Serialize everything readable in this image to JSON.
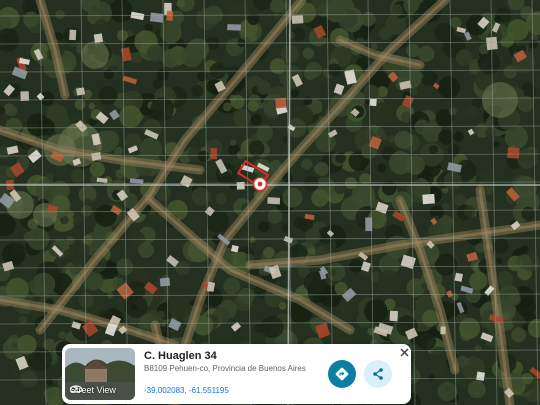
{
  "map": {
    "type": "satellite",
    "marker_icon": "location-pin-icon",
    "parcel_outline_color": "#e8262b",
    "grid_color": "#9aa39a"
  },
  "place_card": {
    "title": "C. Huaglen 34",
    "address": "B8109 Pehuen-co, Provincia de Buenos Aires",
    "coordinates": "-39.002083, -61.551195",
    "street_view_label": "Street View",
    "street_view_icon": "street-view-icon",
    "directions_icon": "directions-icon",
    "share_icon": "share-icon",
    "close_icon": "close-icon",
    "directions_color": "#0b7fa3",
    "share_bg_color": "#d9f0fb"
  }
}
